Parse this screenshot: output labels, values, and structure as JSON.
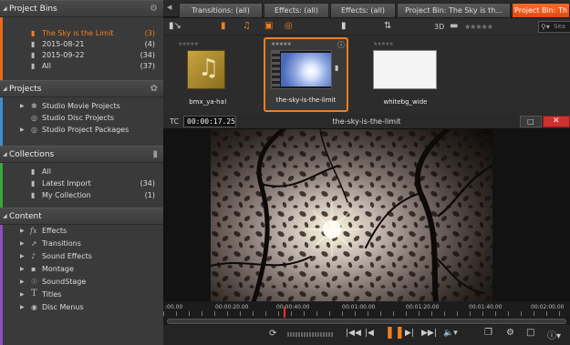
{
  "sidebar": {
    "project_bins": {
      "title": "Project Bins",
      "items": [
        {
          "label": "The Sky is the Limit",
          "count": "(3)"
        },
        {
          "label": "2015-08-21",
          "count": "(4)"
        },
        {
          "label": "2015-09-22",
          "count": "(34)"
        },
        {
          "label": "All",
          "count": "(37)"
        }
      ]
    },
    "projects": {
      "title": "Projects",
      "items": [
        {
          "label": "Studio Movie Projects"
        },
        {
          "label": "Studio Disc Projects"
        },
        {
          "label": "Studio Project Packages"
        }
      ]
    },
    "collections": {
      "title": "Collections",
      "items": [
        {
          "label": "All",
          "count": ""
        },
        {
          "label": "Latest Import",
          "count": "(34)"
        },
        {
          "label": "My Collection",
          "count": "(1)"
        }
      ]
    },
    "content": {
      "title": "Content",
      "items": [
        {
          "label": "Effects"
        },
        {
          "label": "Transitions"
        },
        {
          "label": "Sound Effects"
        },
        {
          "label": "Montage"
        },
        {
          "label": "SoundStage"
        },
        {
          "label": "Titles"
        },
        {
          "label": "Disc Menus"
        }
      ]
    }
  },
  "tabs": [
    {
      "label": "Transitions: (all)"
    },
    {
      "label": "Effects: (all)"
    },
    {
      "label": "Effects: (all)"
    },
    {
      "label": "Project Bin: The Sky is th..."
    },
    {
      "label": "Project Bin: Th"
    }
  ],
  "toolbar": {
    "three_d": "3D",
    "search_placeholder": "Sea"
  },
  "assets": [
    {
      "name": "bmx_ya-ha!"
    },
    {
      "name": "the-sky-is-the-limit"
    },
    {
      "name": "whitebg_wide"
    }
  ],
  "player": {
    "tc_label": "TC",
    "timecode": "00:00:17.25",
    "title": "the-sky-is-the-limit",
    "progress": 0.295,
    "ruler_ticks": [
      ":00.00",
      "00:00:20.00",
      "00:00:40.00",
      "00:01:00.00",
      "00:01:20.00",
      "00:01:40.00",
      "00:02:00.00"
    ]
  },
  "colors": {
    "accent": "#f08020",
    "active_tab": "#f05a1a",
    "close_button": "#d03030"
  },
  "icons": {
    "sidebar_project_bins": "gear-icon",
    "sidebar_projects": "puzzle-icon",
    "sidebar_collections": "collection-icon",
    "asset_info": "info-icon",
    "asset_folder": "folder-icon"
  }
}
